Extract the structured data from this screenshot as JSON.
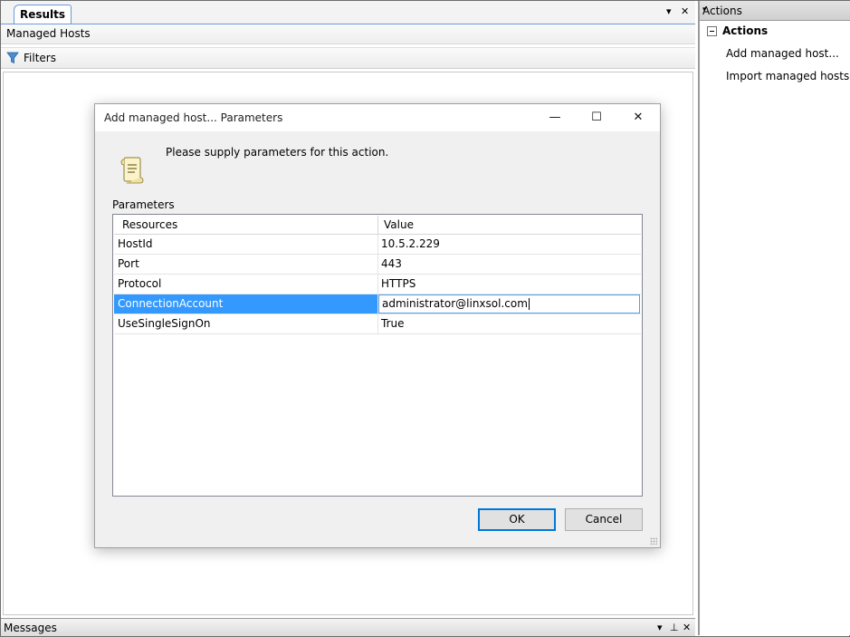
{
  "results_pane": {
    "tab_label": "Results",
    "header_title": "Managed Hosts",
    "filters_label": "Filters",
    "ctrl_dropdown": "▾",
    "ctrl_close": "✕"
  },
  "messages": {
    "label": "Messages",
    "ctrl_dropdown": "▾",
    "ctrl_pin": "⊥",
    "ctrl_close": "✕"
  },
  "actions": {
    "header": "Actions",
    "header_dropdown": "▾",
    "group_label": "Actions",
    "items": [
      {
        "label": "Add managed host..."
      },
      {
        "label": "Import managed hosts..."
      }
    ]
  },
  "dialog": {
    "title": "Add managed host... Parameters",
    "minimize": "—",
    "maximize": "☐",
    "close": "✕",
    "prompt": "Please supply parameters for this action.",
    "params_label": "Parameters",
    "columns": [
      "Resources",
      "Value"
    ],
    "rows": [
      {
        "name": "HostId",
        "value": "10.5.2.229"
      },
      {
        "name": "Port",
        "value": "443"
      },
      {
        "name": "Protocol",
        "value": "HTTPS"
      },
      {
        "name": "ConnectionAccount",
        "value": "administrator@linxsol.com"
      },
      {
        "name": "UseSingleSignOn",
        "value": "True"
      }
    ],
    "selected_row": 3,
    "ok_label": "OK",
    "cancel_label": "Cancel"
  },
  "colors": {
    "selection": "#3399ff",
    "tab_border": "#6b9ad8",
    "default_button_border": "#0078d7"
  }
}
